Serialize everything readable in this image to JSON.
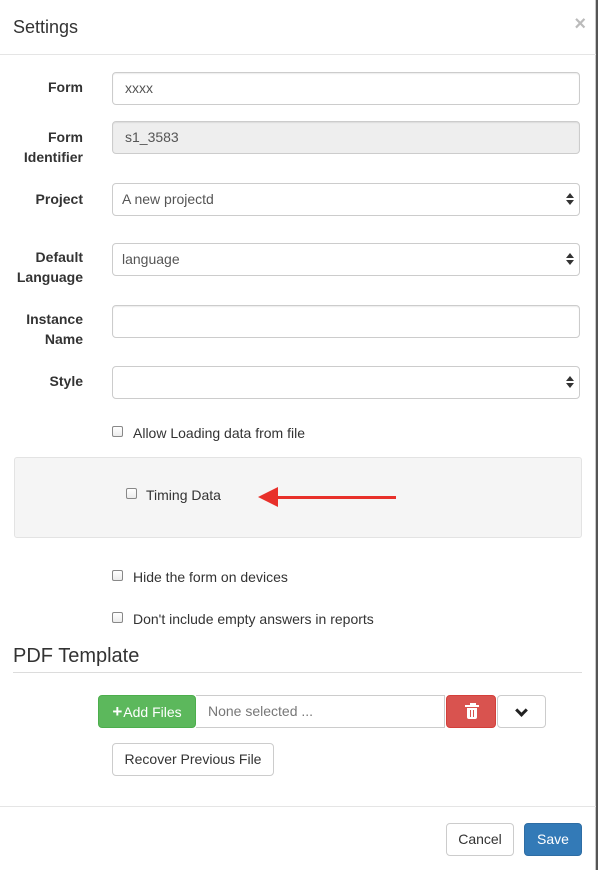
{
  "dialog": {
    "title": "Settings",
    "close_glyph": "×"
  },
  "form": {
    "form_label": "Form",
    "form_value": "xxxx",
    "identifier_label_line1": "Form",
    "identifier_label_line2": "Identifier",
    "identifier_value": "s1_3583",
    "project_label": "Project",
    "project_value": "A new projectd",
    "language_label_line1": "Default",
    "language_label_line2": "Language",
    "language_value": "language",
    "instance_label_line1": "Instance",
    "instance_label_line2": "Name",
    "instance_value": "",
    "style_label": "Style",
    "style_value": ""
  },
  "checkboxes": {
    "allow_loading": {
      "label": "Allow Loading data from file",
      "checked": false
    },
    "timing_data": {
      "label": "Timing Data",
      "checked": false
    },
    "hide_form": {
      "label": "Hide the form on devices",
      "checked": false
    },
    "no_empty_answers": {
      "label": "Don't include empty answers in reports",
      "checked": false
    }
  },
  "annotation": {
    "arrow_color": "#e8302a"
  },
  "pdf": {
    "section_title": "PDF Template",
    "add_files_label": "Add Files",
    "file_placeholder": "None selected ...",
    "recover_label": "Recover Previous File"
  },
  "footer": {
    "cancel_label": "Cancel",
    "save_label": "Save"
  },
  "colors": {
    "primary": "#337ab7",
    "success": "#5cb85c",
    "danger": "#d9534f"
  },
  "icons": {
    "add": "plus-icon",
    "delete": "trash-icon",
    "dropdown": "chevron-down-icon",
    "close": "close-icon"
  }
}
